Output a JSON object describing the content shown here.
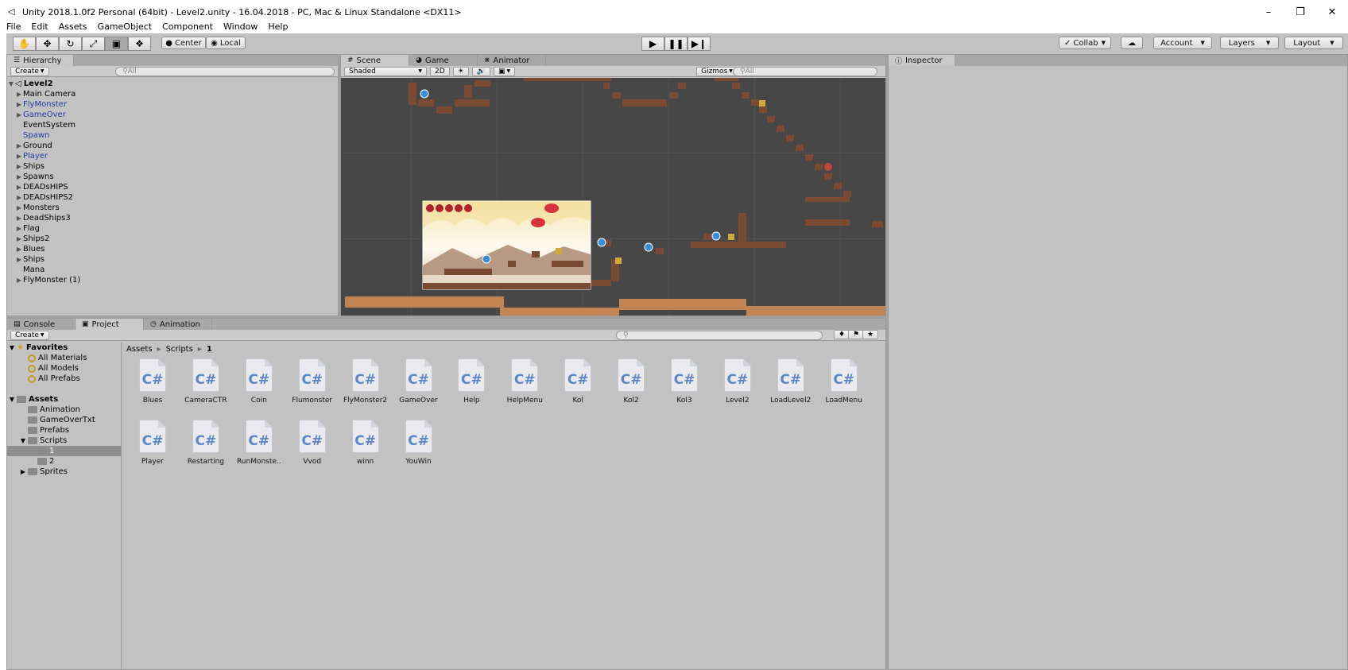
{
  "window": {
    "title": "Unity 2018.1.0f2 Personal (64bit) - Level2.unity - 16.04.2018 - PC, Mac & Linux Standalone <DX11>",
    "icon": "unity-icon"
  },
  "menu": [
    "File",
    "Edit",
    "Assets",
    "GameObject",
    "Component",
    "Window",
    "Help"
  ],
  "toolbar": {
    "tools": [
      "hand-tool",
      "move-tool",
      "rotate-tool",
      "scale-tool",
      "rect-tool",
      "transform-tool"
    ],
    "pivot": "Center",
    "space": "Local",
    "collab": "Collab",
    "account": "Account",
    "layers": "Layers",
    "layout": "Layout"
  },
  "hierarchy": {
    "tab": "Hierarchy",
    "create": "Create",
    "search_placeholder": "All",
    "scene": "Level2",
    "items": [
      {
        "label": "Main Camera",
        "arrow": true,
        "prefab": false
      },
      {
        "label": "FlyMonster",
        "arrow": true,
        "prefab": true
      },
      {
        "label": "GameOver",
        "arrow": true,
        "prefab": true
      },
      {
        "label": "EventSystem",
        "arrow": false,
        "prefab": false
      },
      {
        "label": "Spawn",
        "arrow": false,
        "prefab": true
      },
      {
        "label": "Ground",
        "arrow": true,
        "prefab": false
      },
      {
        "label": "Player",
        "arrow": true,
        "prefab": true
      },
      {
        "label": "Ships",
        "arrow": true,
        "prefab": false
      },
      {
        "label": "Spawns",
        "arrow": true,
        "prefab": false
      },
      {
        "label": "DEADsHIPS",
        "arrow": true,
        "prefab": false
      },
      {
        "label": "DEADsHIPS2",
        "arrow": true,
        "prefab": false
      },
      {
        "label": "Monsters",
        "arrow": true,
        "prefab": false
      },
      {
        "label": "DeadShips3",
        "arrow": true,
        "prefab": false
      },
      {
        "label": "Flag",
        "arrow": true,
        "prefab": false
      },
      {
        "label": "Ships2",
        "arrow": true,
        "prefab": false
      },
      {
        "label": "Blues",
        "arrow": true,
        "prefab": false
      },
      {
        "label": "Ships",
        "arrow": true,
        "prefab": false
      },
      {
        "label": "Mana",
        "arrow": false,
        "prefab": false
      },
      {
        "label": "FlyMonster (1)",
        "arrow": true,
        "prefab": false
      }
    ]
  },
  "scene_view": {
    "tabs": [
      "Scene",
      "Game",
      "Animator"
    ],
    "shading": "Shaded",
    "mode_2d": "2D",
    "gizmos": "Gizmos",
    "search_placeholder": "All"
  },
  "inspector": {
    "tab": "Inspector"
  },
  "project": {
    "tabs": [
      "Console",
      "Project",
      "Animation"
    ],
    "create": "Create",
    "favorites_label": "Favorites",
    "favorites": [
      "All Materials",
      "All Models",
      "All Prefabs"
    ],
    "assets_label": "Assets",
    "folders": [
      "Animation",
      "GameOverTxt",
      "Prefabs",
      "Scripts"
    ],
    "script_subfolders": [
      "1",
      "2"
    ],
    "sprites": "Sprites",
    "breadcrumb": [
      "Assets",
      "Scripts",
      "1"
    ],
    "files": [
      "Blues",
      "CameraCTR",
      "Coin",
      "Flumonster",
      "FlyMonster2",
      "GameOver",
      "Help",
      "HelpMenu",
      "Kol",
      "Kol2",
      "Kol3",
      "Level2",
      "LoadLevel2",
      "LoadMenu",
      "Player",
      "Restarting",
      "RunMonste..",
      "Vvod",
      "winn",
      "YouWin"
    ],
    "file_icon_text": "C#"
  }
}
